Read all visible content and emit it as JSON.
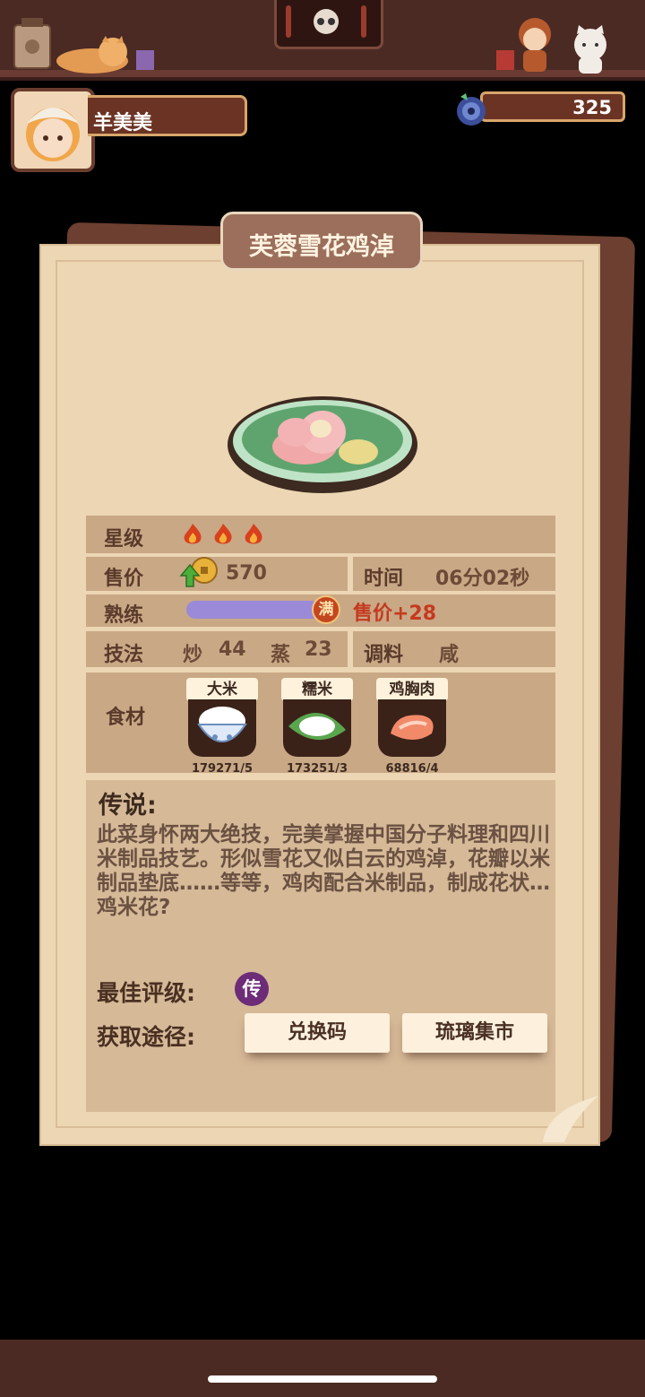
{
  "player": {
    "name": "羊美美",
    "coins": "325"
  },
  "dish": {
    "name": "芙蓉雪花鸡淖",
    "star_label": "星级",
    "stars": 3,
    "price_label": "售价",
    "price": "570",
    "time_label": "时间",
    "time": "06分02秒",
    "skill_label": "熟练",
    "skill_progress": 1.0,
    "skill_badge": "满",
    "skill_bonus": "售价+28",
    "technique_label": "技法",
    "techniques": [
      {
        "name": "炒",
        "value": "44"
      },
      {
        "name": "蒸",
        "value": "23"
      }
    ],
    "seasoning_label": "调料",
    "seasoning": "咸",
    "ingredients_label": "食材",
    "ingredients": [
      {
        "name": "大米",
        "count": "179271/5"
      },
      {
        "name": "糯米",
        "count": "173251/3"
      },
      {
        "name": "鸡胸肉",
        "count": "68816/4"
      }
    ],
    "lore_title": "传说:",
    "lore_text": "此菜身怀两大绝技，完美掌握中国分子料理和四川米制品技艺。形似雪花又似白云的鸡淖，花瓣以米制品垫底……等等，鸡肉配合米制品，制成花状…鸡米花?",
    "best_rank_label": "最佳评级:",
    "best_rank": "传",
    "source_label": "获取途径:",
    "sources": [
      "兑换码",
      "琉璃集市"
    ]
  },
  "colors": {
    "accent": "#c53a1f",
    "panel": "#ecd6b3",
    "row": "#c9a886"
  }
}
